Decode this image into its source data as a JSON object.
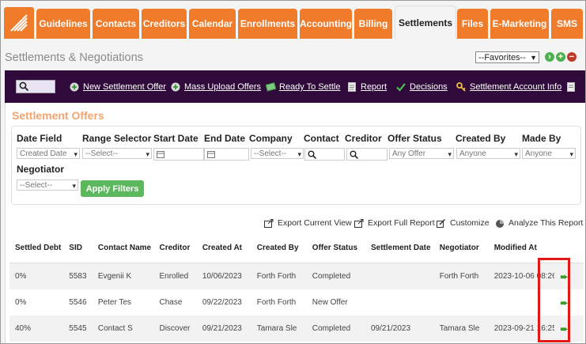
{
  "nav": {
    "tabs": [
      {
        "label": "Guidelines",
        "active": false
      },
      {
        "label": "Contacts",
        "active": false
      },
      {
        "label": "Creditors",
        "active": false
      },
      {
        "label": "Calendar",
        "active": false
      },
      {
        "label": "Enrollments",
        "active": false
      },
      {
        "label": "Accounting",
        "active": false
      },
      {
        "label": "Billing",
        "active": false
      },
      {
        "label": "Settlements",
        "active": true
      },
      {
        "label": "Files",
        "active": false
      },
      {
        "label": "E-Marketing",
        "active": false
      },
      {
        "label": "SMS",
        "active": false
      }
    ]
  },
  "page": {
    "title": "Settlements & Negotiations",
    "favorites": "--Favorites--"
  },
  "toolbar": {
    "actions": [
      {
        "label": "New Settlement Offer",
        "icon": "plus-circle-icon"
      },
      {
        "label": "Mass Upload Offers",
        "icon": "plus-circle-icon"
      },
      {
        "label": "Ready To Settle",
        "icon": "money-icon"
      },
      {
        "label": "Report",
        "icon": "report-icon"
      },
      {
        "label": "Decisions",
        "icon": "checkmark-icon"
      },
      {
        "label": "Settlement Account Info",
        "icon": "key-icon"
      }
    ]
  },
  "offers": {
    "section_title": "Settlement Offers",
    "filters": {
      "date_field": {
        "label": "Date Field",
        "value": "Created Date"
      },
      "range_selector": {
        "label": "Range Selector",
        "value": "--Select--"
      },
      "start_date": {
        "label": "Start Date"
      },
      "end_date": {
        "label": "End Date"
      },
      "company": {
        "label": "Company",
        "value": "--Select--"
      },
      "contact": {
        "label": "Contact"
      },
      "creditor": {
        "label": "Creditor"
      },
      "offer_status": {
        "label": "Offer Status",
        "value": "Any Offer"
      },
      "created_by": {
        "label": "Created By",
        "value": "Anyone"
      },
      "made_by": {
        "label": "Made By",
        "value": "Anyone"
      },
      "negotiator": {
        "label": "Negotiator",
        "value": "--Select--"
      },
      "apply_label": "Apply Filters"
    },
    "exports": {
      "current": "Export Current View",
      "full": "Export Full Report",
      "customize": "Customize",
      "analyze": "Analyze This Report"
    },
    "columns": [
      "Settled Debt",
      "SID",
      "Contact Name",
      "Creditor",
      "Created At",
      "Created By",
      "Offer Status",
      "Settlement Date",
      "Negotiator",
      "Modified At"
    ],
    "rows": [
      [
        "0%",
        "5583",
        "Evgenii K",
        "Enrolled",
        "10/06/2023",
        "Forth Forth",
        "Completed",
        "",
        "Forth Forth",
        "2023-10-06 08:26:"
      ],
      [
        "0%",
        "5546",
        "Peter Tes",
        "Chase",
        "09/22/2023",
        "Forth Forth",
        "New Offer",
        "",
        "",
        ""
      ],
      [
        "40%",
        "5545",
        "Contact S",
        "Discover",
        "09/21/2023",
        "Tamara Sle",
        "Completed",
        "09/21/2023",
        "Tamara Sle",
        "2023-09-21 16:25:"
      ]
    ]
  }
}
